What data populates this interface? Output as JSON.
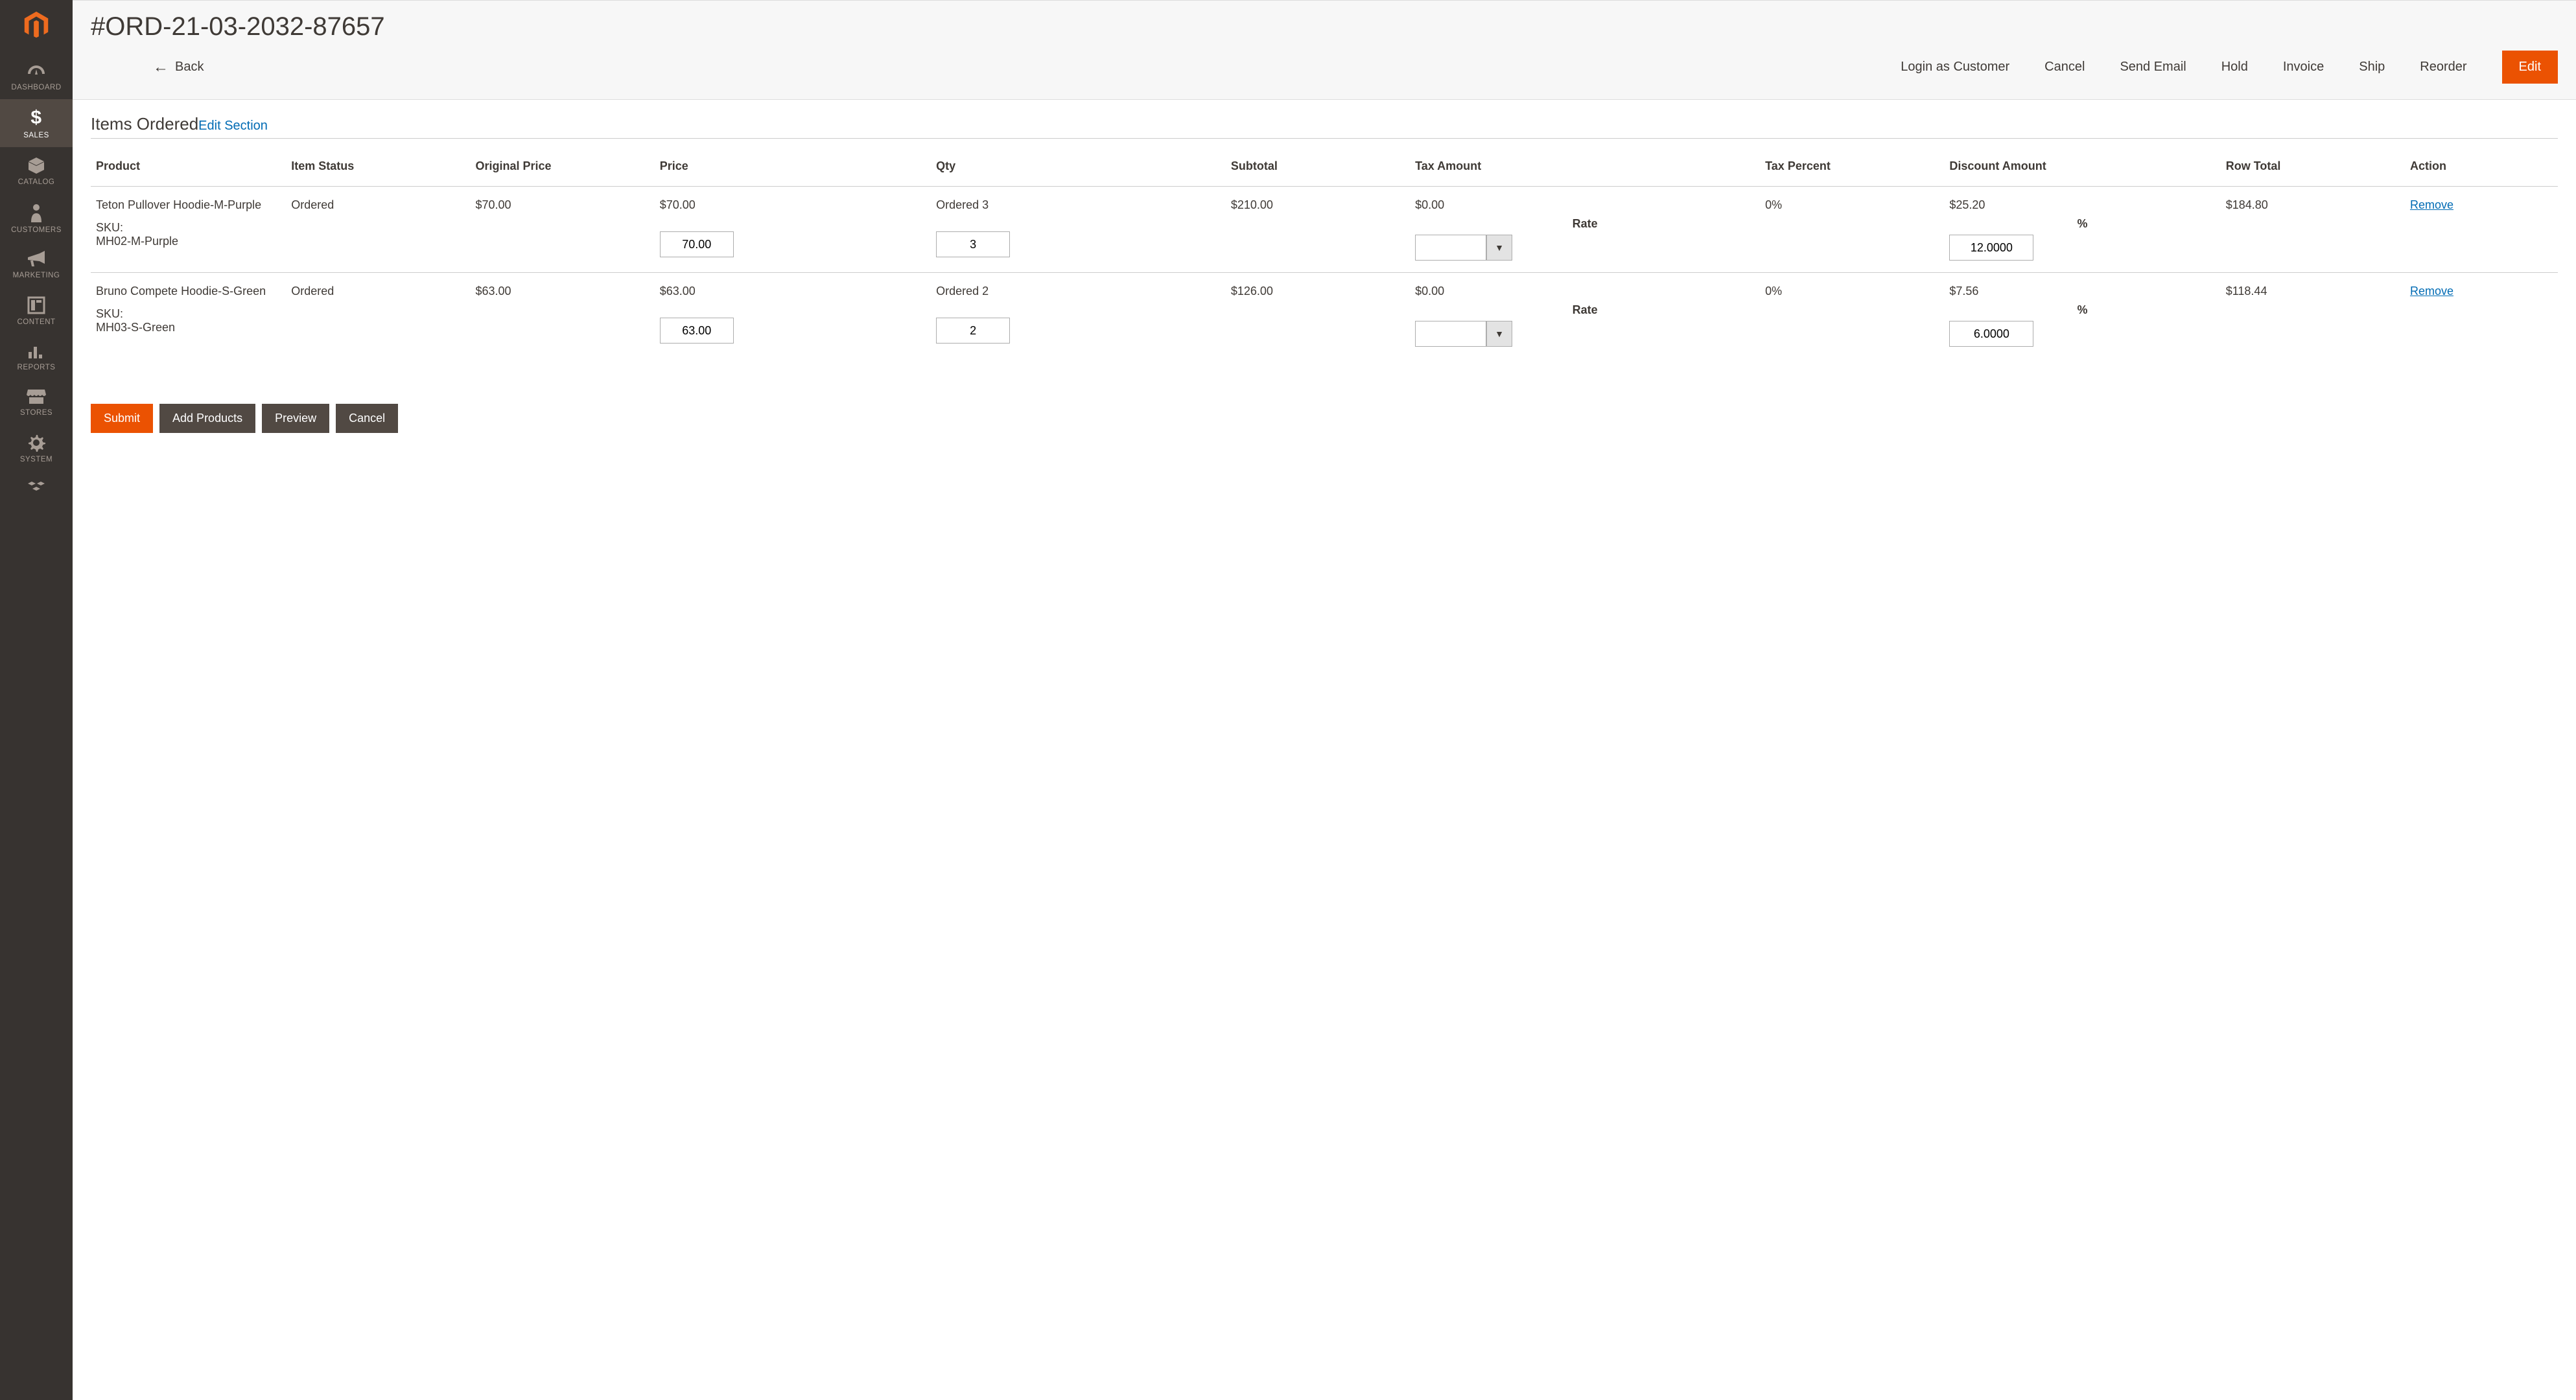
{
  "sidebar": {
    "items": [
      {
        "label": "DASHBOARD"
      },
      {
        "label": "SALES"
      },
      {
        "label": "CATALOG"
      },
      {
        "label": "CUSTOMERS"
      },
      {
        "label": "MARKETING"
      },
      {
        "label": "CONTENT"
      },
      {
        "label": "REPORTS"
      },
      {
        "label": "STORES"
      },
      {
        "label": "SYSTEM"
      }
    ]
  },
  "header": {
    "title": "#ORD-21-03-2032-87657",
    "actions": {
      "back": "Back",
      "login_as_customer": "Login as Customer",
      "cancel": "Cancel",
      "send_email": "Send Email",
      "hold": "Hold",
      "invoice": "Invoice",
      "ship": "Ship",
      "reorder": "Reorder",
      "edit": "Edit"
    }
  },
  "section": {
    "title": "Items Ordered",
    "edit_link": "Edit Section"
  },
  "table": {
    "headers": {
      "product": "Product",
      "item_status": "Item Status",
      "original_price": "Original Price",
      "price": "Price",
      "qty": "Qty",
      "subtotal": "Subtotal",
      "tax_amount": "Tax Amount",
      "tax_percent": "Tax Percent",
      "discount_amount": "Discount Amount",
      "row_total": "Row Total",
      "action": "Action"
    },
    "sub_labels": {
      "rate": "Rate",
      "percent": "%"
    },
    "rows": [
      {
        "name": "Teton Pullover Hoodie-M-Purple",
        "sku_label": "SKU:",
        "sku": "MH02-M-Purple",
        "status": "Ordered",
        "original_price": "$70.00",
        "price": "$70.00",
        "price_input": "70.00",
        "qty_label": "Ordered 3",
        "qty_input": "3",
        "subtotal": "$210.00",
        "tax_amount": "$0.00",
        "rate_input": "",
        "tax_percent": "0%",
        "discount_amount": "$25.20",
        "discount_pct_input": "12.0000",
        "row_total": "$184.80",
        "action": "Remove"
      },
      {
        "name": "Bruno Compete Hoodie-S-Green",
        "sku_label": "SKU:",
        "sku": "MH03-S-Green",
        "status": "Ordered",
        "original_price": "$63.00",
        "price": "$63.00",
        "price_input": "63.00",
        "qty_label": "Ordered 2",
        "qty_input": "2",
        "subtotal": "$126.00",
        "tax_amount": "$0.00",
        "rate_input": "",
        "tax_percent": "0%",
        "discount_amount": "$7.56",
        "discount_pct_input": "6.0000",
        "row_total": "$118.44",
        "action": "Remove"
      }
    ]
  },
  "footer": {
    "submit": "Submit",
    "add_products": "Add Products",
    "preview": "Preview",
    "cancel": "Cancel"
  }
}
